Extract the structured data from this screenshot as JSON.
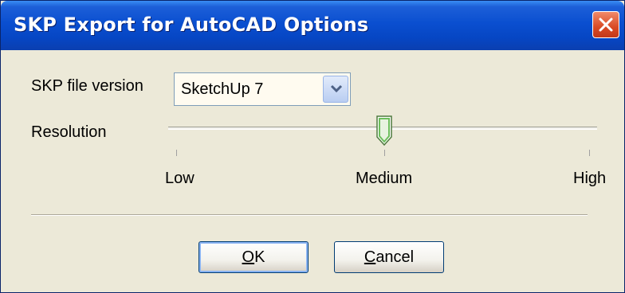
{
  "window": {
    "title": "SKP Export for AutoCAD Options"
  },
  "form": {
    "file_version_label": "SKP file version",
    "file_version_value": "SketchUp 7",
    "resolution_label": "Resolution",
    "resolution_value": "Medium",
    "resolution_options": [
      "Low",
      "Medium",
      "High"
    ]
  },
  "buttons": {
    "ok_mnemonic": "O",
    "ok_rest": "K",
    "cancel_mnemonic": "C",
    "cancel_rest": "ancel"
  },
  "icons": {
    "close": "close-icon",
    "dropdown": "chevron-down-icon",
    "slider_thumb": "slider-thumb-icon"
  },
  "colors": {
    "titlebar": "#0a4fd0",
    "dialog_bg": "#ece9d8",
    "close_button": "#d94a24",
    "slider_thumb": "#4fa84a"
  }
}
